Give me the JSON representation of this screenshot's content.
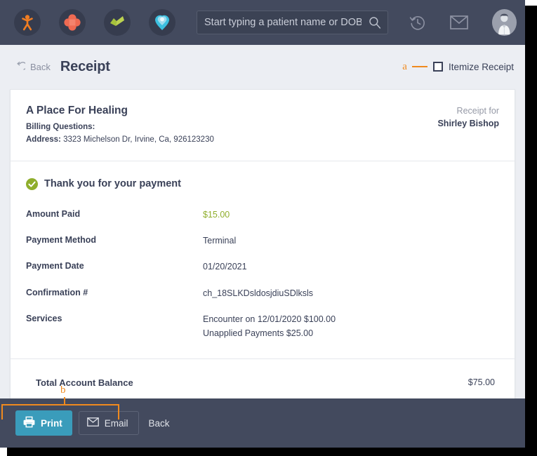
{
  "topbar": {
    "app_icons": [
      {
        "name": "kareo-logo-icon",
        "label": "K"
      },
      {
        "name": "medical-cross-icon",
        "label": ""
      },
      {
        "name": "green-check-tasks-icon",
        "label": ""
      },
      {
        "name": "heart-pin-icon",
        "label": ""
      }
    ],
    "search": {
      "placeholder": "Start typing a patient name or DOB",
      "value": ""
    },
    "nav_icons": [
      {
        "name": "history-clock-icon"
      },
      {
        "name": "envelope-icon"
      },
      {
        "name": "user-avatar"
      }
    ]
  },
  "page_header": {
    "back_label": "Back",
    "title": "Receipt",
    "annotation_a": "a",
    "itemize_label": "Itemize Receipt",
    "itemize_checked": false
  },
  "receipt": {
    "practice_name": "A Place For Healing",
    "billing_questions_label": "Billing Questions:",
    "address_label": "Address:",
    "address_value": "3323 Michelson Dr, Irvine, Ca, 926123230",
    "receipt_for_label": "Receipt for",
    "receipt_for_name": "Shirley Bishop",
    "thank_you": "Thank you for your payment",
    "details": [
      {
        "label": "Amount Paid",
        "values": [
          "$15.00"
        ],
        "style": "amount"
      },
      {
        "label": "Payment Method",
        "values": [
          "Terminal"
        ],
        "style": "plain"
      },
      {
        "label": "Payment Date",
        "values": [
          "01/20/2021"
        ],
        "style": "plain"
      },
      {
        "label": "Confirmation #",
        "values": [
          "ch_18SLKDsldosjdiuSDlksls"
        ],
        "style": "plain"
      },
      {
        "label": "Services",
        "values": [
          "Encounter on 12/01/2020 $100.00",
          "Unapplied Payments $25.00"
        ],
        "style": "plain"
      }
    ],
    "total_label": "Total Account Balance",
    "total_value": "$75.00"
  },
  "action_bar": {
    "annotation_b": "b",
    "print_label": "Print",
    "email_label": "Email",
    "back_label": "Back"
  },
  "colors": {
    "topbar_bg": "#434a5e",
    "page_bg": "#eceef3",
    "accent_teal": "#3a9cbb",
    "amount_green": "#8fae2c",
    "annotation_orange": "#f08a1e",
    "text_dark": "#3a4158"
  }
}
